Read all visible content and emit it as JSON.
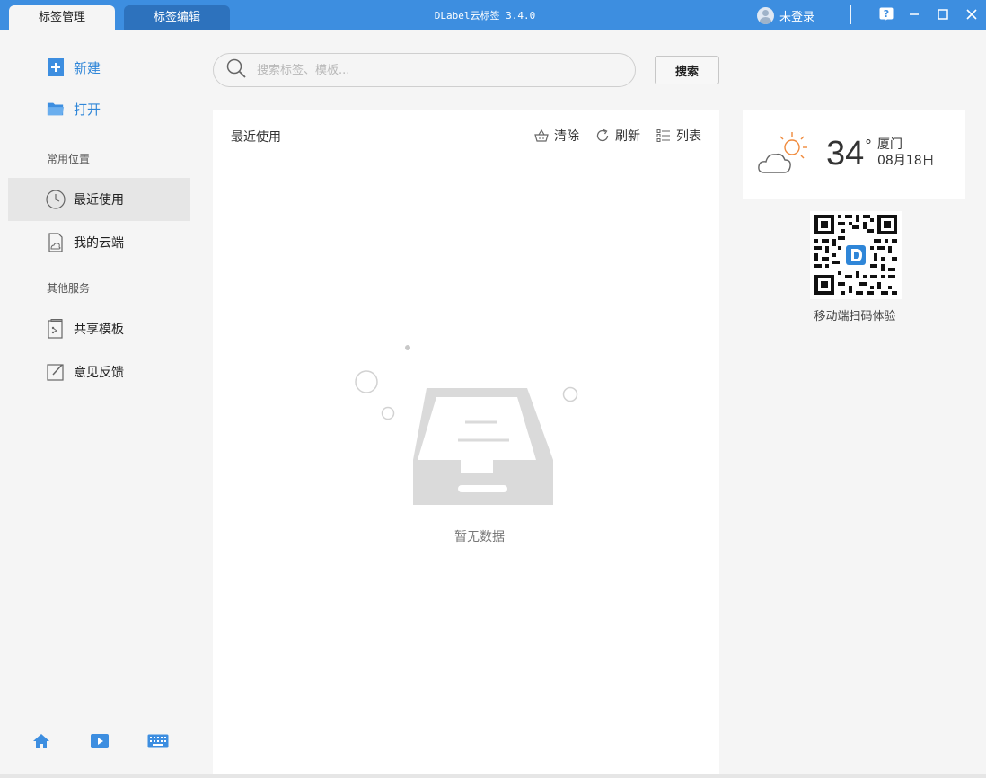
{
  "titlebar": {
    "tabs": [
      {
        "label": "标签管理",
        "active": true
      },
      {
        "label": "标签编辑",
        "active": false
      }
    ],
    "app_title": "DLabel云标签 3.4.0",
    "login_label": "未登录",
    "help_icon": "question-mark-icon",
    "accent_color": "#3d8ee0"
  },
  "sidebar": {
    "actions": [
      {
        "label": "新建",
        "icon": "new-file-icon"
      },
      {
        "label": "打开",
        "icon": "folder-icon"
      }
    ],
    "section_common": "常用位置",
    "common_items": [
      {
        "label": "最近使用",
        "icon": "clock-icon",
        "active": true
      },
      {
        "label": "我的云端",
        "icon": "cloud-document-icon",
        "active": false
      }
    ],
    "section_other": "其他服务",
    "other_items": [
      {
        "label": "共享模板",
        "icon": "template-icon"
      },
      {
        "label": "意见反馈",
        "icon": "edit-icon"
      }
    ],
    "bottom_icons": [
      "home-icon",
      "video-play-icon",
      "keyboard-icon"
    ]
  },
  "search": {
    "placeholder": "搜索标签、模板...",
    "value": "",
    "button_label": "搜索"
  },
  "main": {
    "title": "最近使用",
    "tools": [
      {
        "label": "清除",
        "icon": "basket-icon"
      },
      {
        "label": "刷新",
        "icon": "refresh-icon"
      },
      {
        "label": "列表",
        "icon": "list-icon"
      }
    ],
    "empty_text": "暂无数据"
  },
  "weather": {
    "temperature": "34",
    "degree": "°",
    "city": "厦门",
    "date": "08月18日",
    "icon": "sun-cloud-icon"
  },
  "qr": {
    "caption": "移动端扫码体验"
  }
}
